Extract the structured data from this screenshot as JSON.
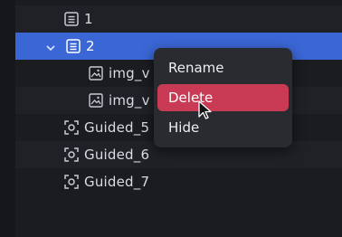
{
  "layers": [
    {
      "label": "1",
      "icon": "document-icon",
      "state": "normal"
    },
    {
      "label": "2",
      "icon": "document-icon",
      "state": "selected",
      "expanded": true
    },
    {
      "label": "img_v",
      "icon": "image-icon",
      "state": "normal"
    },
    {
      "label": "img_v",
      "icon": "image-icon",
      "state": "normal"
    },
    {
      "label": "Guided_5",
      "icon": "focus-frame-icon",
      "state": "normal"
    },
    {
      "label": "Guided_6",
      "icon": "focus-frame-icon",
      "state": "normal"
    },
    {
      "label": "Guided_7",
      "icon": "focus-frame-icon",
      "state": "normal"
    }
  ],
  "context_menu": {
    "items": [
      {
        "label": "Rename",
        "highlighted": false
      },
      {
        "label": "Delete",
        "highlighted": true
      },
      {
        "label": "Hide",
        "highlighted": false
      }
    ]
  },
  "colors": {
    "selected_row": "#3b67d6",
    "menu_highlight": "#c93b54",
    "menu_background": "#2a2b31"
  }
}
